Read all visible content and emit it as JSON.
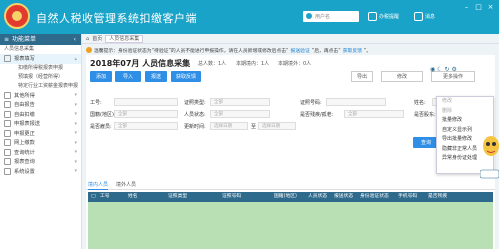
{
  "app": {
    "title": "自然人税收管理系统扣缴客户端"
  },
  "titlebar": {
    "user_placeholder": "用户名",
    "buttons": [
      "办税提醒",
      "消息"
    ],
    "icons": [
      "user-icon",
      "bell-icon",
      "mail-icon",
      "minimize-icon",
      "maximize-icon",
      "close-icon"
    ]
  },
  "sidebar": {
    "header": "功能菜单",
    "first_item": "人员信息采集",
    "items": [
      {
        "label": "报表填写",
        "subitems": [
          "扣缴所得税报表申报",
          "预填报（经营所得）",
          "特定行业工资薪金报表申报"
        ]
      },
      {
        "label": "其他所得"
      },
      {
        "label": "自由报告"
      },
      {
        "label": "自由扣缴"
      },
      {
        "label": "申报表报送"
      },
      {
        "label": "申报更正"
      },
      {
        "label": "网上缴款"
      },
      {
        "label": "查询统计"
      },
      {
        "label": "报表查询"
      },
      {
        "label": "系统设置"
      }
    ]
  },
  "breadcrumb": {
    "home": "首页",
    "tab": "人员信息采集"
  },
  "notice": {
    "text": "温馨提示：身份验证状态为“待验证”的人员不能进行申报操作，请在人员新增或修改后点击“",
    "link1": "报送验证",
    "text2": "”后，再点击“",
    "link2": "获取反馈",
    "text3": "”。"
  },
  "period": {
    "label": "2018年07月 人员信息采集"
  },
  "stats": {
    "total": "总人数：1人",
    "domestic": "本期境内：1人",
    "foreign": "本期境外：0人"
  },
  "toolbar": {
    "add": "添加",
    "import": "导入",
    "submit": "报送",
    "feedback": "获取反馈",
    "right_buttons": [
      "导出",
      "修改",
      "更多操作"
    ],
    "search_btn": "查询"
  },
  "filters": {
    "row1": [
      {
        "label": "工号:",
        "value": ""
      },
      {
        "label": "证照类型:",
        "value": "全部"
      },
      {
        "label": "证照号码:",
        "value": ""
      },
      {
        "label": "姓名:",
        "value": ""
      }
    ],
    "row2": [
      {
        "label": "国籍(地区):",
        "value": "全部"
      },
      {
        "label": "人员状态:",
        "value": "全部"
      },
      {
        "label": "是否残疾/孤老:",
        "value": "全部"
      },
      {
        "label": "是否股东:",
        "value": "全部"
      }
    ],
    "row3": [
      {
        "label": "是否雇员:",
        "value": "全部"
      },
      {
        "label": "更新时间:",
        "value": "选择日期"
      },
      {
        "label": "至",
        "value": "选择日期"
      }
    ]
  },
  "tabs": [
    "境内人员",
    "境外人员"
  ],
  "table": {
    "columns": [
      "工号",
      "姓名",
      "证照类型",
      "证照号码",
      "国籍(地区)",
      "人员状态",
      "报送状态",
      "身份验证状态",
      "手机号码",
      "是否残疾"
    ]
  },
  "dropdown": {
    "items": [
      {
        "label": "修改",
        "disabled": true
      },
      {
        "label": "删除",
        "disabled": true
      },
      {
        "label": "批量修改",
        "disabled": false
      },
      {
        "label": "自定义显示列",
        "disabled": false
      },
      {
        "label": "导出批量修改",
        "disabled": false
      },
      {
        "label": "隐藏非正常人员",
        "disabled": false
      },
      {
        "label": "异常身份证处理",
        "disabled": false
      }
    ]
  },
  "colors": {
    "titlebar": "#1aa3c8",
    "primary": "#2f8fe6",
    "table_header": "#2e6a8c",
    "table_body": "#b8e0b4"
  }
}
